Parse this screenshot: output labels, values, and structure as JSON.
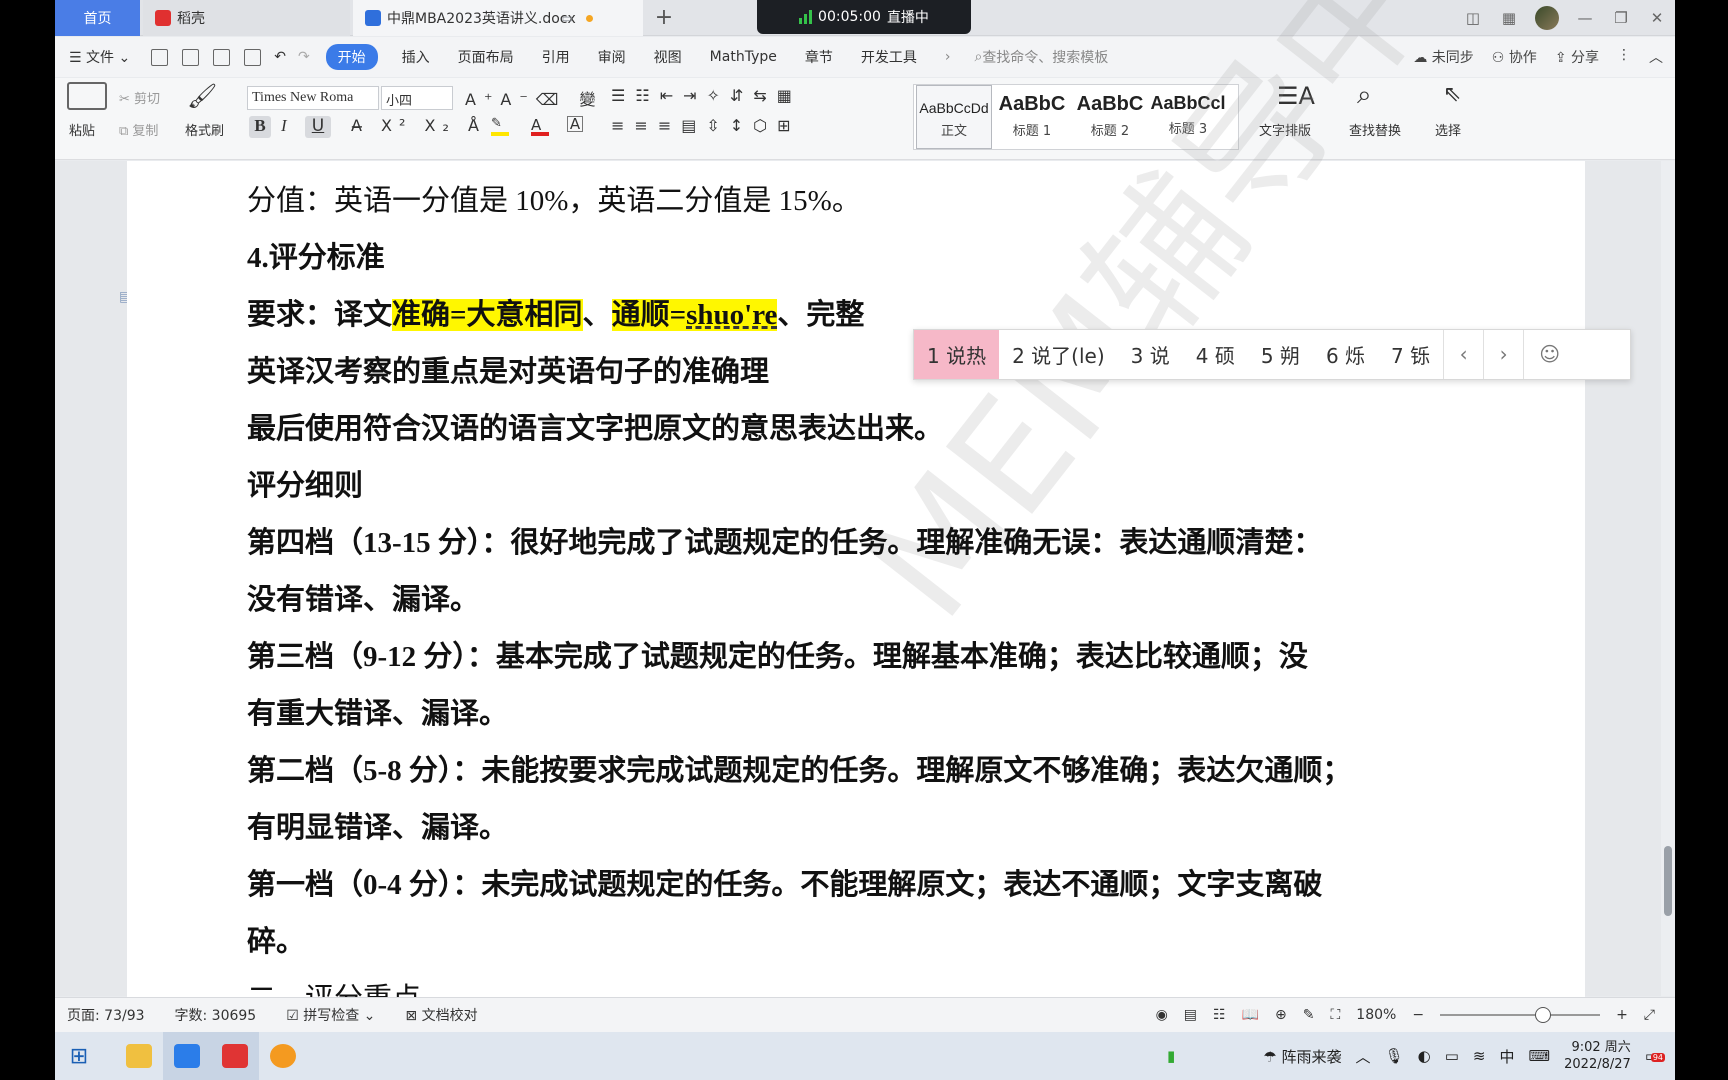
{
  "tabs": {
    "home": "首页",
    "daoke": "稻壳",
    "doc": "中鼎MBA2023英语讲义.docx"
  },
  "live": {
    "timer": "00:05:00",
    "label": "直播中"
  },
  "menu": {
    "file": "文件",
    "start": "开始",
    "insert": "插入",
    "layout": "页面布局",
    "ref": "引用",
    "review": "审阅",
    "view": "视图",
    "mathtype": "MathType",
    "chapter": "章节",
    "dev": "开发工具",
    "search": "查找命令、搜索模板",
    "unsync": "未同步",
    "collab": "协作",
    "share": "分享"
  },
  "ribbon": {
    "paste": "粘贴",
    "cut": "剪切",
    "copy": "复制",
    "brush": "格式刷",
    "font": "Times New Roma",
    "size": "小四",
    "textlayout": "文字排版",
    "findreplace": "查找替换",
    "select": "选择"
  },
  "styles": [
    {
      "preview": "AaBbCcDd",
      "name": "正文"
    },
    {
      "preview": "AaBbC",
      "name": "标题 1"
    },
    {
      "preview": "AaBbC",
      "name": "标题 2"
    },
    {
      "preview": "AaBbCcl",
      "name": "标题 3"
    }
  ],
  "doc": {
    "l1": "分值：英语一分值是 10%，英语二分值是 15%。",
    "l2": "4.评分标准",
    "l3a": "要求：译文",
    "l3b": "准确=大意相同",
    "l3c": "、",
    "l3d": "通顺=",
    "l3e": "shuo're",
    "l3f": "、完整",
    "l4": "英译汉考察的重点是对英语句子的准确理",
    "l5": "最后使用符合汉语的语言文字把原文的意思表达出来。",
    "l6": "评分细则",
    "l7": "第四档（13-15 分）：很好地完成了试题规定的任务。理解准确无误：表达通顺清楚：",
    "l8": "没有错译、漏译。",
    "l9": "第三档（9-12 分）：基本完成了试题规定的任务。理解基本准确；表达比较通顺；没",
    "l10": "有重大错译、漏译。",
    "l11": "第二档（5-8 分）：未能按要求完成试题规定的任务。理解原文不够准确；表达欠通顺；",
    "l12": "有明显错译、漏译。",
    "l13": "第一档（0-4 分）：未完成试题规定的任务。不能理解原文；表达不通顺；文字支离破",
    "l14": "碎。",
    "l15": "二、评分重点"
  },
  "ime": {
    "candidates": [
      "1 说热",
      "2 说了(le)",
      "3 说",
      "4 硕",
      "5 朔",
      "6 烁",
      "7 铄"
    ]
  },
  "status": {
    "page": "页面: 73/93",
    "words": "字数: 30695",
    "spell": "拼写检查",
    "proof": "文档校对",
    "zoom": "180%"
  },
  "taskbar": {
    "weather": "阵雨来袭",
    "ime": "中",
    "time": "9:02 周六",
    "date": "2022/8/27",
    "badge": "94"
  },
  "watermark": "MEM辅导中心"
}
